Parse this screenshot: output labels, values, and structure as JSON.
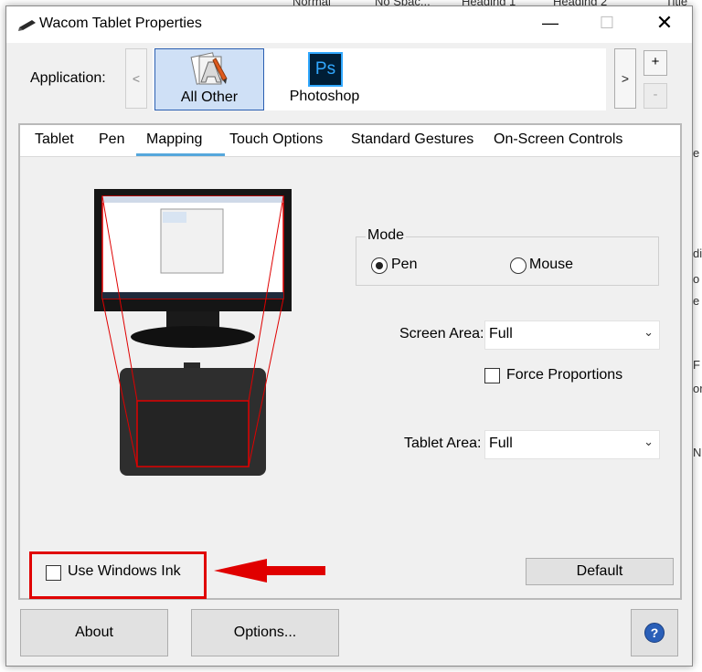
{
  "background_doc": {
    "ribbon_items": [
      "Normal",
      "No Spac...",
      "Heading 1",
      "Heading 2",
      "Title"
    ],
    "edge_letters": [
      "e",
      "di",
      "o",
      "e",
      "F",
      "or",
      "N"
    ]
  },
  "window": {
    "title": "Wacom Tablet Properties",
    "minimize_glyph": "—",
    "maximize_glyph": "☐",
    "close_glyph": "✕"
  },
  "application": {
    "label": "Application:",
    "prev_glyph": "<",
    "next_glyph": ">",
    "add_glyph": "+",
    "remove_glyph": "-",
    "apps": [
      {
        "name": "All Other",
        "selected": true
      },
      {
        "name": "Photoshop",
        "selected": false,
        "icon_text": "Ps"
      }
    ]
  },
  "tabs": [
    "Tablet",
    "Pen",
    "Mapping",
    "Touch Options",
    "Standard Gestures",
    "On-Screen Controls"
  ],
  "active_tab": "Mapping",
  "mapping": {
    "mode": {
      "legend": "Mode",
      "options": [
        "Pen",
        "Mouse"
      ],
      "selected": "Pen"
    },
    "screen_area": {
      "label": "Screen Area:",
      "value": "Full"
    },
    "force_proportions": {
      "label": "Force Proportions",
      "checked": false
    },
    "tablet_area": {
      "label": "Tablet Area:",
      "value": "Full"
    },
    "use_windows_ink": {
      "label": "Use Windows Ink",
      "checked": false
    },
    "default_label": "Default"
  },
  "footer": {
    "about_label": "About",
    "options_label": "Options...",
    "help_glyph": "?"
  },
  "colors": {
    "highlight_red": "#e00000",
    "tab_underline": "#55a7dc",
    "photoshop_blue": "#31a8ff",
    "photoshop_bg": "#001e36",
    "selected_tile": "#cfe0f6"
  }
}
